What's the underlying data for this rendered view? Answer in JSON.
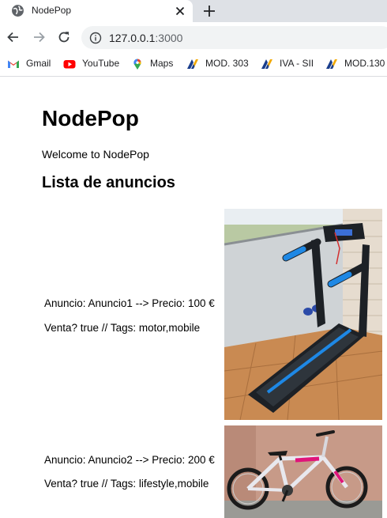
{
  "browser": {
    "tab": {
      "title": "NodePop"
    },
    "address": {
      "host": "127.0.0.1",
      "port": ":3000"
    },
    "bookmarks": [
      {
        "label": "Gmail",
        "icon": "gmail-icon"
      },
      {
        "label": "YouTube",
        "icon": "youtube-icon"
      },
      {
        "label": "Maps",
        "icon": "maps-icon"
      },
      {
        "label": "MOD. 303",
        "icon": "aeat-icon"
      },
      {
        "label": "IVA - SII",
        "icon": "aeat-icon"
      },
      {
        "label": "MOD.130",
        "icon": "aeat-icon"
      }
    ]
  },
  "page": {
    "title": "NodePop",
    "welcome": "Welcome to NodePop",
    "list_heading": "Lista de anuncios",
    "ads": [
      {
        "line1": "Anuncio: Anuncio1 --> Precio: 100 €",
        "line2": "Venta? true // Tags: motor,mobile",
        "image": "treadmill-photo"
      },
      {
        "line1": "Anuncio: Anuncio2 --> Precio: 200 €",
        "line2": "Venta? true // Tags: lifestyle,mobile",
        "image": "bicycle-photo"
      }
    ]
  }
}
